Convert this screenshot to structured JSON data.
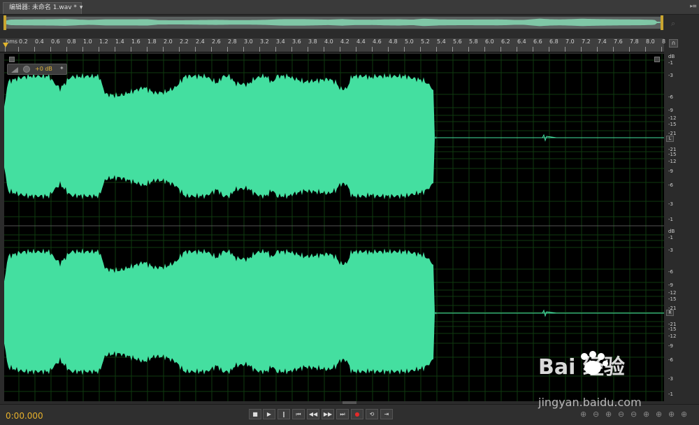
{
  "tab": {
    "title": "编辑器: 未命名 1.wav *",
    "close": "▾"
  },
  "panel_menu": "▸≡",
  "ruler": {
    "unit": "hms",
    "ticks": [
      "0.2",
      "0.4",
      "0.6",
      "0.8",
      "1.0",
      "1.2",
      "1.4",
      "1.6",
      "1.8",
      "2.0",
      "2.2",
      "2.4",
      "2.6",
      "2.8",
      "3.0",
      "3.2",
      "3.4",
      "3.6",
      "3.8",
      "4.0",
      "4.2",
      "4.4",
      "4.6",
      "4.8",
      "5.0",
      "5.2",
      "5.4",
      "5.6",
      "5.8",
      "6.0",
      "6.2",
      "6.4",
      "6.6",
      "6.8",
      "7.0",
      "7.2",
      "7.4",
      "7.6",
      "7.8",
      "8.0",
      "8"
    ]
  },
  "hud": {
    "gain": "+0 dB"
  },
  "channels": [
    {
      "label": "L",
      "scale": [
        "dB",
        "-1",
        "-3",
        "-6",
        "-9",
        "-12",
        "-15",
        "-21",
        "-∞",
        "-21",
        "-15",
        "-12",
        "-9",
        "-6",
        "-3",
        "-1"
      ]
    },
    {
      "label": "R",
      "scale": [
        "dB",
        "-1",
        "-3",
        "-6",
        "-9",
        "-12",
        "-15",
        "-21",
        "-∞",
        "-21",
        "-15",
        "-12",
        "-9",
        "-6",
        "-3",
        "-1"
      ]
    }
  ],
  "transport": {
    "time": "0:00.000",
    "buttons": [
      {
        "name": "stop",
        "glyph": "■"
      },
      {
        "name": "play",
        "glyph": "▶"
      },
      {
        "name": "pause",
        "glyph": "‖"
      },
      {
        "name": "go-start",
        "glyph": "⏮"
      },
      {
        "name": "rewind",
        "glyph": "◀◀"
      },
      {
        "name": "fast-forward",
        "glyph": "▶▶"
      },
      {
        "name": "go-end",
        "glyph": "⏭"
      },
      {
        "name": "record",
        "glyph": "●"
      },
      {
        "name": "loop",
        "glyph": "⟲"
      },
      {
        "name": "skip-selection",
        "glyph": "⇥"
      }
    ]
  },
  "watermark": {
    "brand": "Bai  经验",
    "url": "jingyan.baidu.com"
  },
  "colors": {
    "waveform": "#44dfa0",
    "grid": "#0f3a0f",
    "accent": "#e3b62c"
  }
}
